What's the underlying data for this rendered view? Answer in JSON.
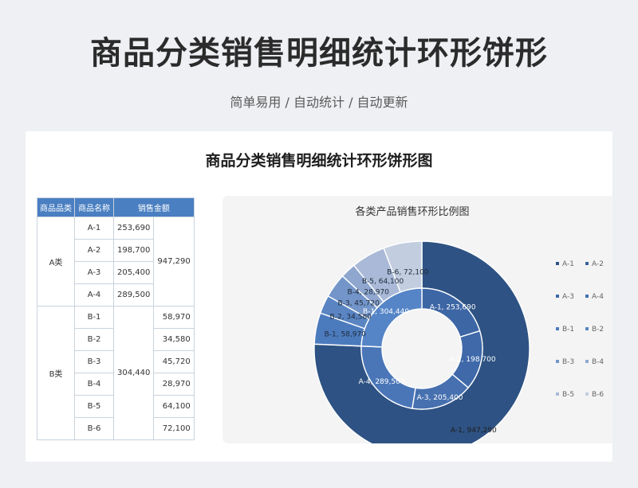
{
  "header": {
    "title": "商品分类销售明细统计环形饼形",
    "subtitle": "简单易用 / 自动统计 / 自动更新"
  },
  "card": {
    "title": "商品分类销售明细统计环形饼形图"
  },
  "table": {
    "headers": [
      "商品品类",
      "商品名称",
      "销售金额"
    ],
    "groups": [
      {
        "category": "A类",
        "total": "947,290",
        "items": [
          {
            "name": "A-1",
            "value": "253,690"
          },
          {
            "name": "A-2",
            "value": "198,700"
          },
          {
            "name": "A-3",
            "value": "205,400"
          },
          {
            "name": "A-4",
            "value": "289,500"
          }
        ]
      },
      {
        "category": "B类",
        "total": "304,440",
        "items": [
          {
            "name": "B-1",
            "value": "58,970"
          },
          {
            "name": "B-2",
            "value": "34,580"
          },
          {
            "name": "B-3",
            "value": "45,720"
          },
          {
            "name": "B-4",
            "value": "28,970"
          },
          {
            "name": "B-5",
            "value": "64,100"
          },
          {
            "name": "B-6",
            "value": "72,100"
          }
        ]
      }
    ]
  },
  "chart_data": {
    "type": "pie",
    "title": "各类产品销售环形比例图",
    "rings": [
      {
        "ring": "outer",
        "slices": [
          {
            "label": "A-1",
            "value": 947290,
            "label_text": "A-1, 947,290"
          },
          {
            "label": "B-1",
            "value": 58970,
            "label_text": "B-1, 58,970"
          },
          {
            "label": "B-2",
            "value": 34580,
            "label_text": "B-2, 34,580"
          },
          {
            "label": "B-3",
            "value": 45720,
            "label_text": "B-3, 45,720"
          },
          {
            "label": "B-4",
            "value": 28970,
            "label_text": "B-4, 28,970"
          },
          {
            "label": "B-5",
            "value": 64100,
            "label_text": "B-5, 64,100"
          },
          {
            "label": "B-6",
            "value": 72100,
            "label_text": "B-6, 72,100"
          }
        ]
      },
      {
        "ring": "inner",
        "slices": [
          {
            "label": "A-1",
            "value": 253690,
            "label_text": "A-1, 253,690"
          },
          {
            "label": "A-2",
            "value": 198700,
            "label_text": "A-2, 198,700"
          },
          {
            "label": "A-3",
            "value": 205400,
            "label_text": "A-3, 205,400"
          },
          {
            "label": "A-4",
            "value": 289500,
            "label_text": "A-4, 289,500"
          },
          {
            "label": "B-1",
            "value": 304440,
            "label_text": "B-1, 304,440"
          }
        ]
      }
    ],
    "legend": {
      "placement": "right",
      "entries": [
        "A-1",
        "A-2",
        "A-3",
        "A-4",
        "B-1",
        "B-2",
        "B-3",
        "B-4",
        "B-5",
        "B-6"
      ]
    },
    "colors": {
      "outer_a": "#2e5283",
      "outer_b": [
        "#4c7bbd",
        "#5a85c2",
        "#7395c9",
        "#8fa7cf",
        "#a9b9d7",
        "#c3cde0"
      ],
      "inner": [
        "#3d66a5",
        "#3f69a9",
        "#4670af",
        "#4a76b8",
        "#5585c7"
      ],
      "legend": [
        "#2e5283",
        "#3a6099",
        "#3e68a6",
        "#4570b0",
        "#4c7bbd",
        "#5a85c2",
        "#7395c9",
        "#8fa7cf",
        "#a9b9d7",
        "#c3cde0"
      ]
    }
  }
}
